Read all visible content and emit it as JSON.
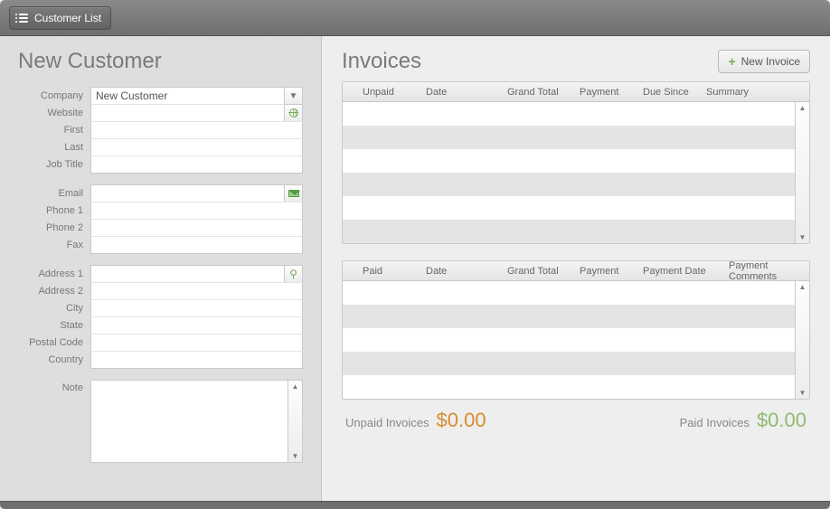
{
  "toolbar": {
    "customer_list_label": "Customer List"
  },
  "left": {
    "title": "New Customer",
    "fields": {
      "company_label": "Company",
      "company_value": "New Customer",
      "website_label": "Website",
      "website_value": "",
      "first_label": "First",
      "first_value": "",
      "last_label": "Last",
      "last_value": "",
      "jobtitle_label": "Job Title",
      "jobtitle_value": "",
      "email_label": "Email",
      "email_value": "",
      "phone1_label": "Phone 1",
      "phone1_value": "",
      "phone2_label": "Phone 2",
      "phone2_value": "",
      "fax_label": "Fax",
      "fax_value": "",
      "address1_label": "Address 1",
      "address1_value": "",
      "address2_label": "Address 2",
      "address2_value": "",
      "city_label": "City",
      "city_value": "",
      "state_label": "State",
      "state_value": "",
      "postal_label": "Postal Code",
      "postal_value": "",
      "country_label": "Country",
      "country_value": "",
      "note_label": "Note",
      "note_value": ""
    }
  },
  "right": {
    "title": "Invoices",
    "new_invoice_label": "New Invoice",
    "unpaid_cols": {
      "c0": "Unpaid",
      "c1": "Date",
      "c2": "Grand Total",
      "c3": "Payment",
      "c4": "Due Since",
      "c5": "Summary"
    },
    "paid_cols": {
      "c0": "Paid",
      "c1": "Date",
      "c2": "Grand Total",
      "c3": "Payment",
      "c4": "Payment Date",
      "c5": "Payment Comments"
    },
    "totals": {
      "unpaid_label": "Unpaid Invoices",
      "unpaid_amount": "$0.00",
      "paid_label": "Paid Invoices",
      "paid_amount": "$0.00"
    }
  }
}
